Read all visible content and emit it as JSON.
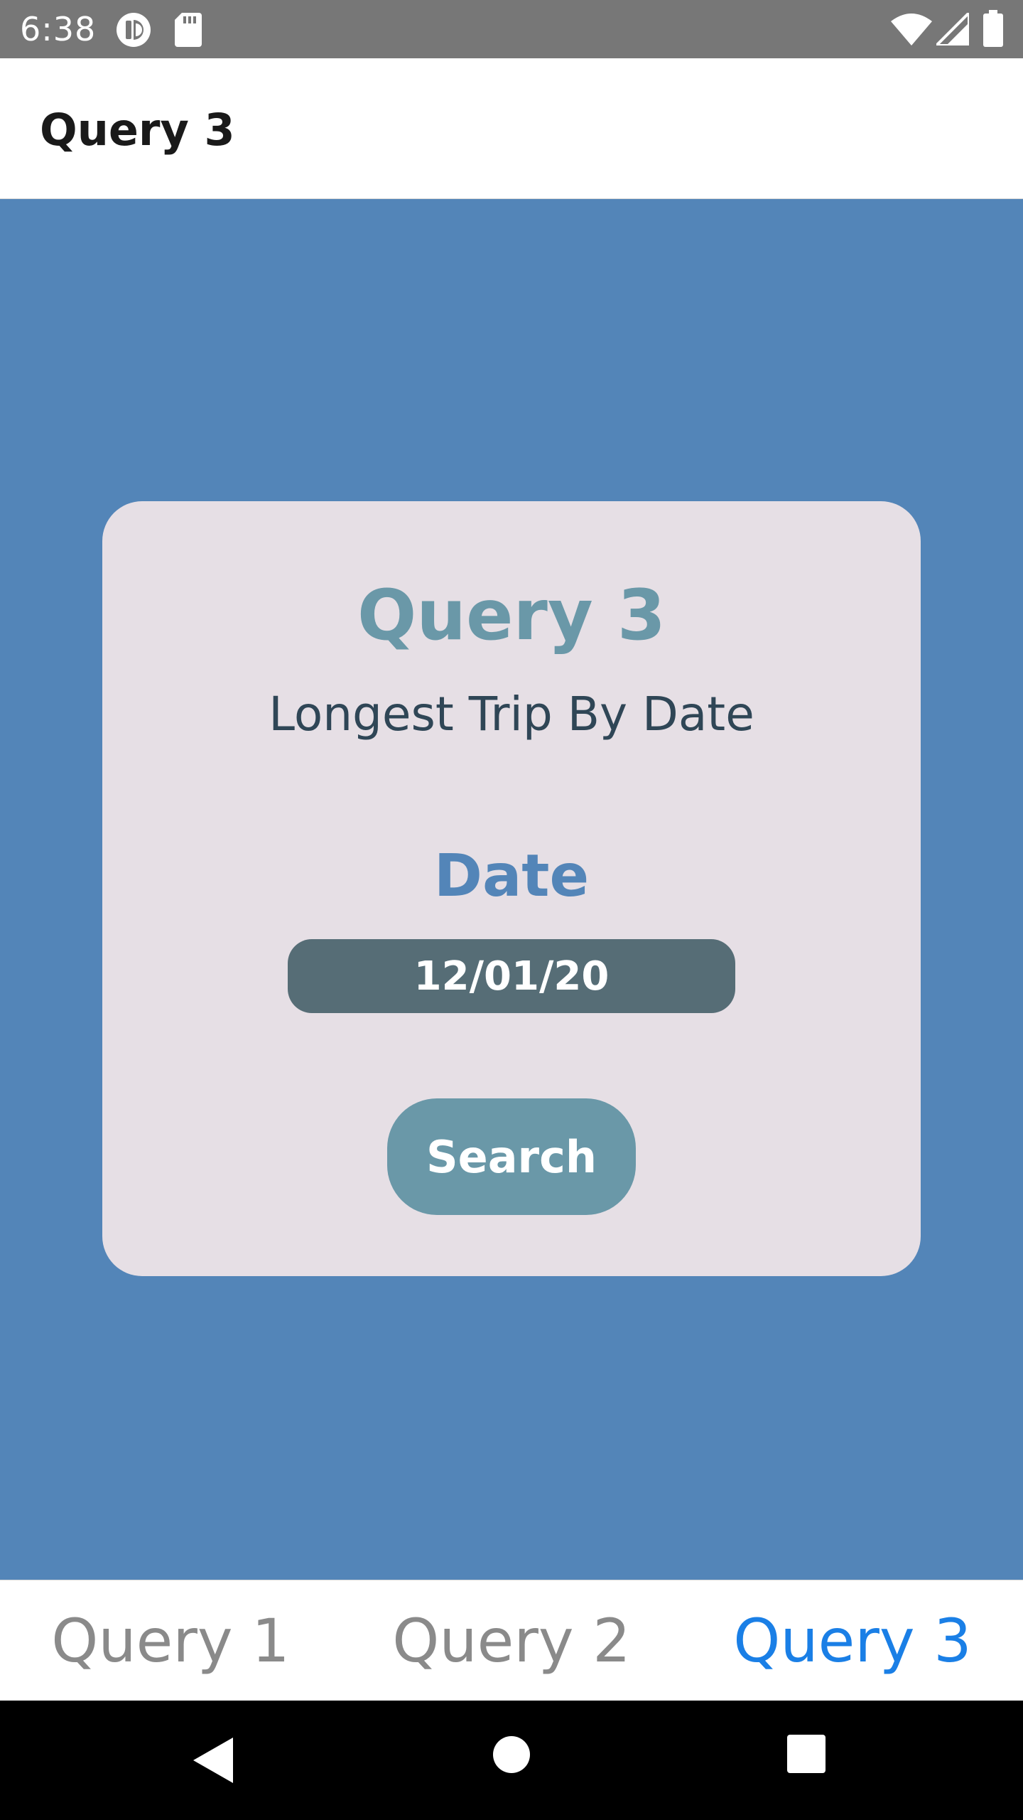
{
  "status_bar": {
    "time": "6:38",
    "icons": [
      "sync-icon",
      "sd-card-icon",
      "wifi-icon",
      "signal-icon",
      "battery-icon"
    ]
  },
  "app_bar": {
    "title": "Query 3"
  },
  "card": {
    "title": "Query 3",
    "subtitle": "Longest Trip By Date",
    "date_label": "Date",
    "date_value": "12/01/20",
    "search_label": "Search"
  },
  "tabs": [
    {
      "label": "Query 1",
      "active": false
    },
    {
      "label": "Query 2",
      "active": false
    },
    {
      "label": "Query 3",
      "active": true
    }
  ],
  "nav_bar": {
    "icons": [
      "back-icon",
      "home-icon",
      "recents-icon"
    ]
  },
  "colors": {
    "status_bar": "#777777",
    "content_background": "#5385b8",
    "card_background": "#e6dfe5",
    "card_title": "#6a98a8",
    "subtitle_text": "#2f4656",
    "date_label": "#5385b8",
    "date_input_background": "#566d76",
    "search_button": "#6a98a8",
    "tab_inactive": "#8a8a8a",
    "tab_active": "#1a7fe6"
  }
}
